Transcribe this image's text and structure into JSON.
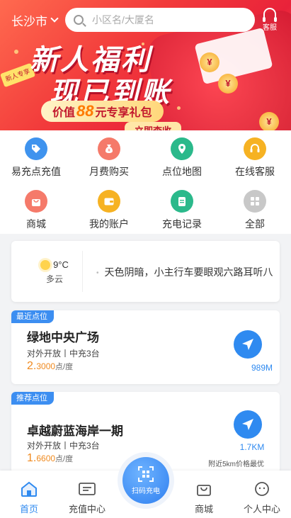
{
  "header": {
    "city": "长沙市",
    "search_placeholder": "小区名/大厦名",
    "service_label": "客服"
  },
  "banner": {
    "line1": "新人福利",
    "line2": "现已到账",
    "pill_prefix": "价值",
    "pill_amount": "88",
    "pill_suffix": "元专享礼包",
    "tag": "新人专享",
    "cta": "立即查收",
    "coin_symbol": "¥"
  },
  "menu": [
    {
      "label": "易充点充值",
      "icon": "tag-icon",
      "color": "#3f93ee"
    },
    {
      "label": "月费购买",
      "icon": "money-bag-icon",
      "color": "#f57a6a"
    },
    {
      "label": "点位地图",
      "icon": "map-pin-icon",
      "color": "#2bb98b"
    },
    {
      "label": "在线客服",
      "icon": "headset-icon",
      "color": "#f6b223"
    },
    {
      "label": "商城",
      "icon": "shopping-bag-icon",
      "color": "#f57a6a"
    },
    {
      "label": "我的账户",
      "icon": "wallet-icon",
      "color": "#f6b223"
    },
    {
      "label": "充电记录",
      "icon": "clipboard-icon",
      "color": "#2bb98b"
    },
    {
      "label": "全部",
      "icon": "grid-icon",
      "color": "#c8c8c8"
    }
  ],
  "weather": {
    "temperature": "9°C",
    "condition": "多云",
    "notice": "天色阴暗，小主行车要眼观六路耳听八方"
  },
  "stations": [
    {
      "tag": "最近点位",
      "name": "绿地中央广场",
      "meta": "对外开放丨中充3台",
      "price_int": "2.",
      "price_dec": "3000",
      "price_unit": "点/度",
      "distance": "989M",
      "hint": ""
    },
    {
      "tag": "推荐点位",
      "name": "卓越蔚蓝海岸一期",
      "meta": "对外开放丨中充3台",
      "price_int": "1.",
      "price_dec": "6600",
      "price_unit": "点/度",
      "distance": "1.7KM",
      "hint": "附近5km价格最优"
    }
  ],
  "tabbar": {
    "tabs": [
      {
        "label": "首页",
        "active": true
      },
      {
        "label": "充值中心",
        "active": false
      },
      {
        "label": "商城",
        "active": false
      },
      {
        "label": "个人中心",
        "active": false
      }
    ],
    "scan_label": "扫码充电"
  },
  "colors": {
    "accent": "#2f8af0",
    "price": "#f08a1f",
    "banner_red": "#e9223a"
  }
}
